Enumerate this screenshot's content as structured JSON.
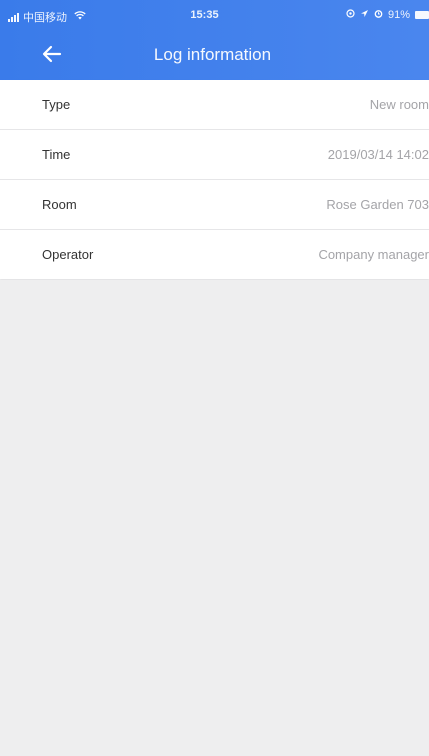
{
  "status_bar": {
    "carrier": "中国移动",
    "time": "15:35",
    "battery": "91%",
    "icons": [
      "signal-icon",
      "wifi-icon",
      "location-icon",
      "alarm-icon",
      "battery-icon"
    ]
  },
  "nav": {
    "title": "Log information",
    "back_icon": "back-arrow-icon"
  },
  "colors": {
    "header": "#3a7bea",
    "value_text": "#a4a4a8",
    "label_text": "#333333",
    "background": "#eeeeef"
  },
  "rows": [
    {
      "label": "Type",
      "value": "New room"
    },
    {
      "label": "Time",
      "value": "2019/03/14 14:02"
    },
    {
      "label": "Room",
      "value": "Rose Garden 703"
    },
    {
      "label": "Operator",
      "value": "Company manager"
    }
  ]
}
